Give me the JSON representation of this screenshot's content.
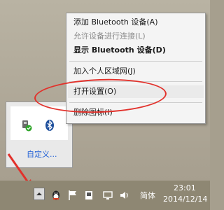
{
  "menu": {
    "items": [
      {
        "label": "添加 Bluetooth 设备(A)",
        "state": "normal"
      },
      {
        "label": "允许设备进行连接(L)",
        "state": "disabled"
      },
      {
        "label": "显示 Bluetooth 设备(D)",
        "state": "bold"
      },
      {
        "label": "加入个人区域网(J)",
        "state": "normal"
      },
      {
        "label": "打开设置(O)",
        "state": "highlighted"
      },
      {
        "label": "删除图标(I)",
        "state": "normal"
      }
    ]
  },
  "tray_popup": {
    "customize_label": "自定义..."
  },
  "taskbar": {
    "language": "简体",
    "time": "23:01",
    "date": "2014/12/14"
  },
  "annotation_colors": {
    "highlight": "#e2312b"
  }
}
